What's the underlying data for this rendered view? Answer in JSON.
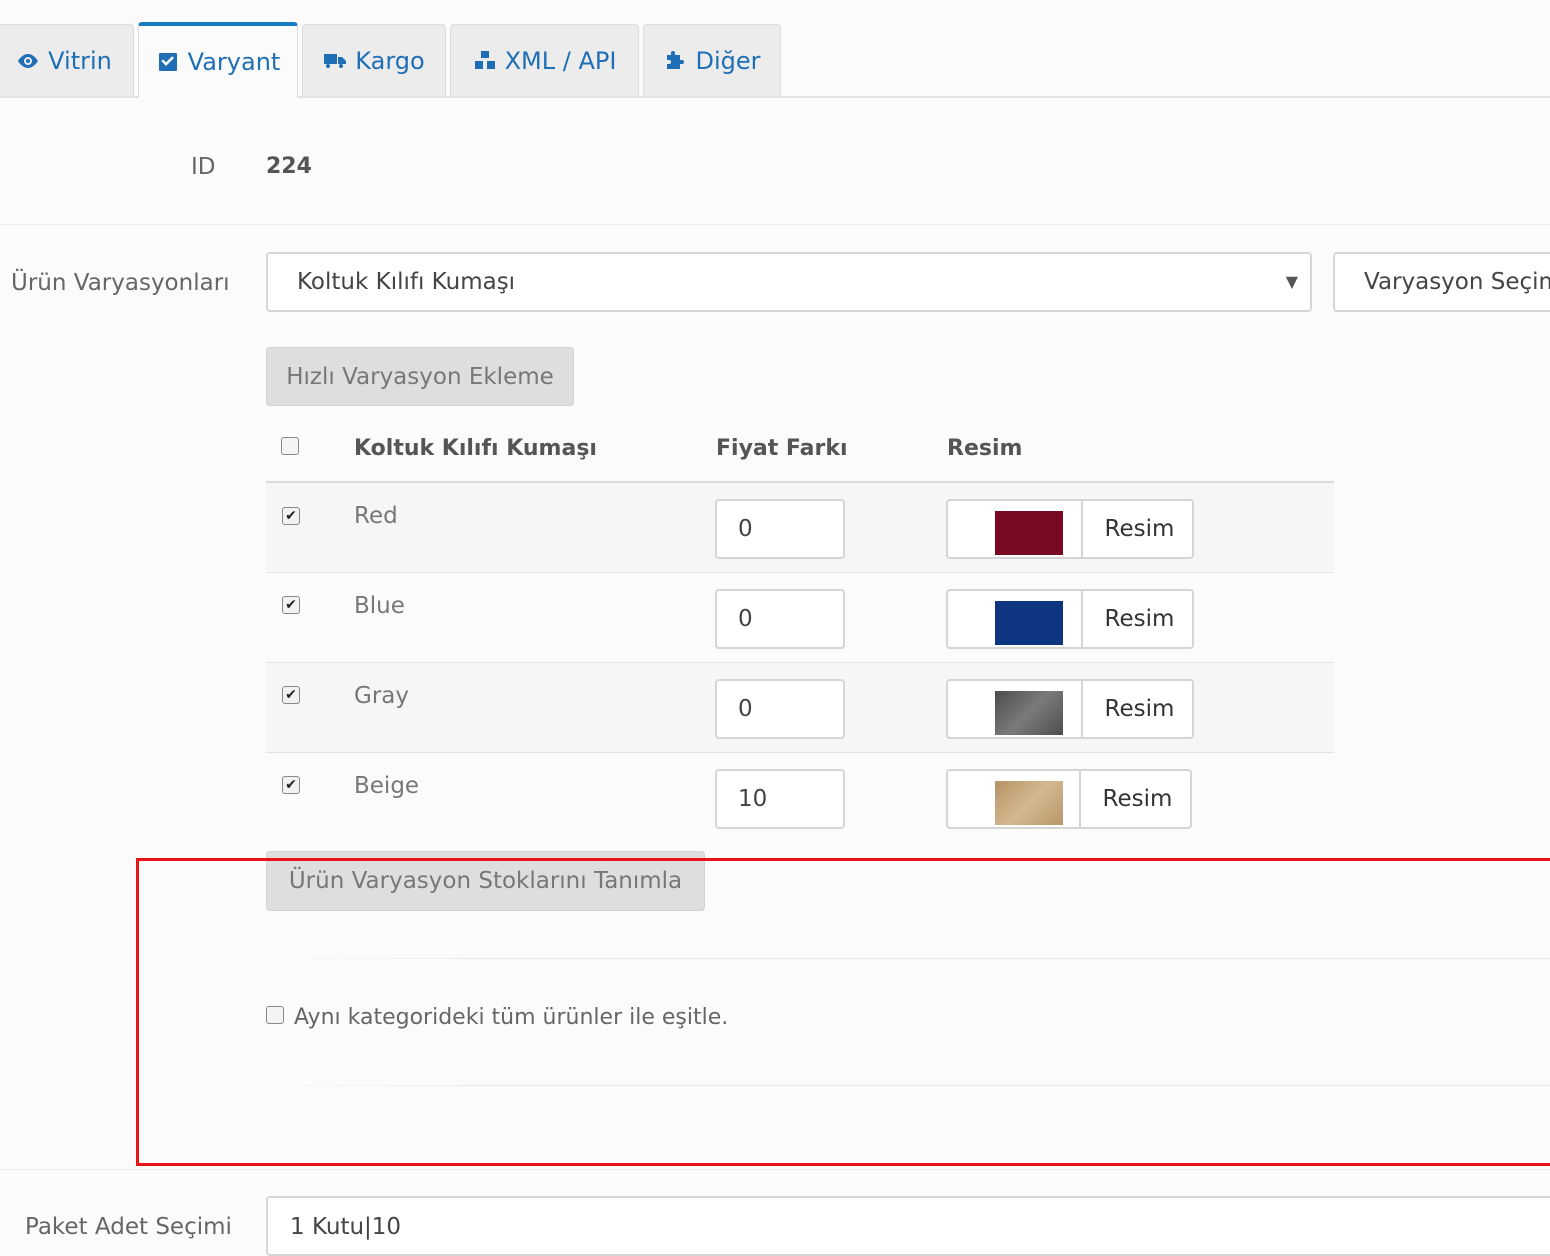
{
  "tabs": [
    {
      "label": "Vitrin",
      "icon": "eye-icon"
    },
    {
      "label": "Varyant",
      "icon": "check-square-icon",
      "active": true
    },
    {
      "label": "Kargo",
      "icon": "truck-icon"
    },
    {
      "label": "XML / API",
      "icon": "cubes-icon"
    },
    {
      "label": "Diğer",
      "icon": "puzzle-icon"
    }
  ],
  "id_field": {
    "label": "ID",
    "value": "224"
  },
  "variations": {
    "label": "Ürün Varyasyonları",
    "selected": "Koltuk Kılıfı Kumaşı",
    "second_select": "Varyasyon Seçim",
    "quick_add_button": "Hızlı Varyasyon Ekleme",
    "table_headers": {
      "name": "Koltuk Kılıfı Kumaşı",
      "price": "Fiyat Farkı",
      "image": "Resim"
    },
    "rows": [
      {
        "name": "Red",
        "price": "0",
        "checked": true,
        "swatch_color": "#7a0a22",
        "image_button": "Resim"
      },
      {
        "name": "Blue",
        "price": "0",
        "checked": true,
        "swatch_color": "#0d3580",
        "image_button": "Resim"
      },
      {
        "name": "Gray",
        "price": "0",
        "checked": true,
        "swatch_color": "#5e5e5e",
        "image_button": "Resim"
      },
      {
        "name": "Beige",
        "price": "10",
        "checked": true,
        "swatch_color": "#c4a57a",
        "image_button": "Resim"
      }
    ],
    "stock_button": "Ürün Varyasyon Stoklarını Tanımla",
    "equalize_checkbox": "Aynı kategorideki tüm ürünler ile eşitle."
  },
  "package": {
    "label": "Paket Adet Seçimi",
    "value": "1 Kutu|10"
  },
  "colors": {
    "accent": "#1a7bc5",
    "highlight": "#e8141a"
  }
}
